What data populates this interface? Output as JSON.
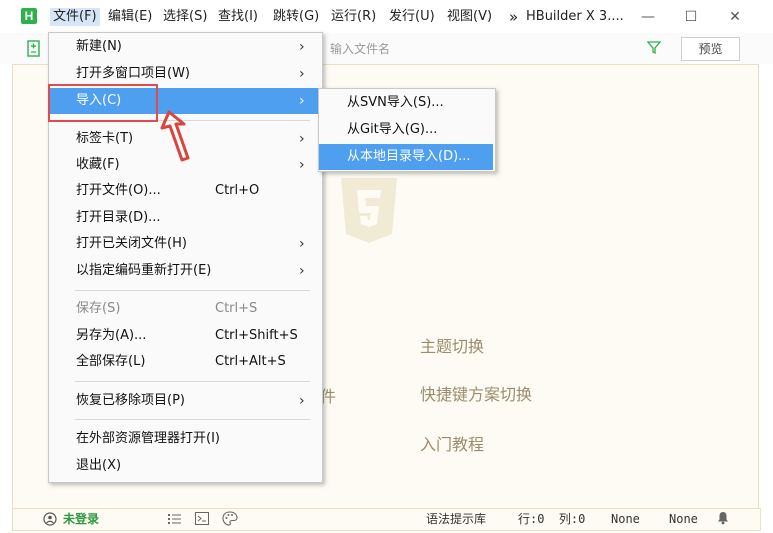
{
  "app": {
    "logo_letter": "H",
    "title": "HBuilder X 3...."
  },
  "menubar": {
    "items": [
      "文件(F)",
      "编辑(E)",
      "选择(S)",
      "查找(I)",
      "跳转(G)",
      "运行(R)",
      "发行(U)",
      "视图(V)"
    ],
    "overflow": "»"
  },
  "window_controls": {
    "minimize": "—",
    "maximize": "☐",
    "close": "✕"
  },
  "toolbar": {
    "search_placeholder": "输入文件名",
    "preview_label": "预览"
  },
  "file_menu": {
    "items": [
      {
        "label": "新建(N)",
        "shortcut": "",
        "arrow": "›"
      },
      {
        "label": "打开多窗口项目(W)",
        "shortcut": "",
        "arrow": "›"
      },
      {
        "label": "导入(C)",
        "shortcut": "",
        "arrow": "›"
      },
      {
        "label": "标签卡(T)",
        "shortcut": "",
        "arrow": "›"
      },
      {
        "label": "收藏(F)",
        "shortcut": "",
        "arrow": "›"
      },
      {
        "label": "打开文件(O)...",
        "shortcut": "Ctrl+O",
        "arrow": ""
      },
      {
        "label": "打开目录(D)...",
        "shortcut": "",
        "arrow": ""
      },
      {
        "label": "打开已关闭文件(H)",
        "shortcut": "",
        "arrow": "›"
      },
      {
        "label": "以指定编码重新打开(E)",
        "shortcut": "",
        "arrow": "›"
      },
      {
        "label": "保存(S)",
        "shortcut": "Ctrl+S",
        "arrow": ""
      },
      {
        "label": "另存为(A)...",
        "shortcut": "Ctrl+Shift+S",
        "arrow": ""
      },
      {
        "label": "全部保存(L)",
        "shortcut": "Ctrl+Alt+S",
        "arrow": ""
      },
      {
        "label": "恢复已移除项目(P)",
        "shortcut": "",
        "arrow": "›"
      },
      {
        "label": "在外部资源管理器打开(I)",
        "shortcut": "",
        "arrow": ""
      },
      {
        "label": "退出(X)",
        "shortcut": "",
        "arrow": ""
      }
    ]
  },
  "import_submenu": {
    "items": [
      "从SVN导入(S)...",
      "从Git导入(G)...",
      "从本地目录导入(D)..."
    ]
  },
  "welcome": {
    "partial_text": "件",
    "links": [
      "主题切换",
      "快捷键方案切换",
      "入门教程"
    ]
  },
  "statusbar": {
    "login": "未登录",
    "syntax_lib": "语法提示库",
    "position": "行:0  列:0",
    "encoding": "None",
    "language": "None"
  },
  "colors": {
    "accent": "#4f9ff1",
    "annotation_red": "#e04b4b",
    "logo_green": "#2bb24c",
    "editor_bg": "#fdfbf3"
  }
}
